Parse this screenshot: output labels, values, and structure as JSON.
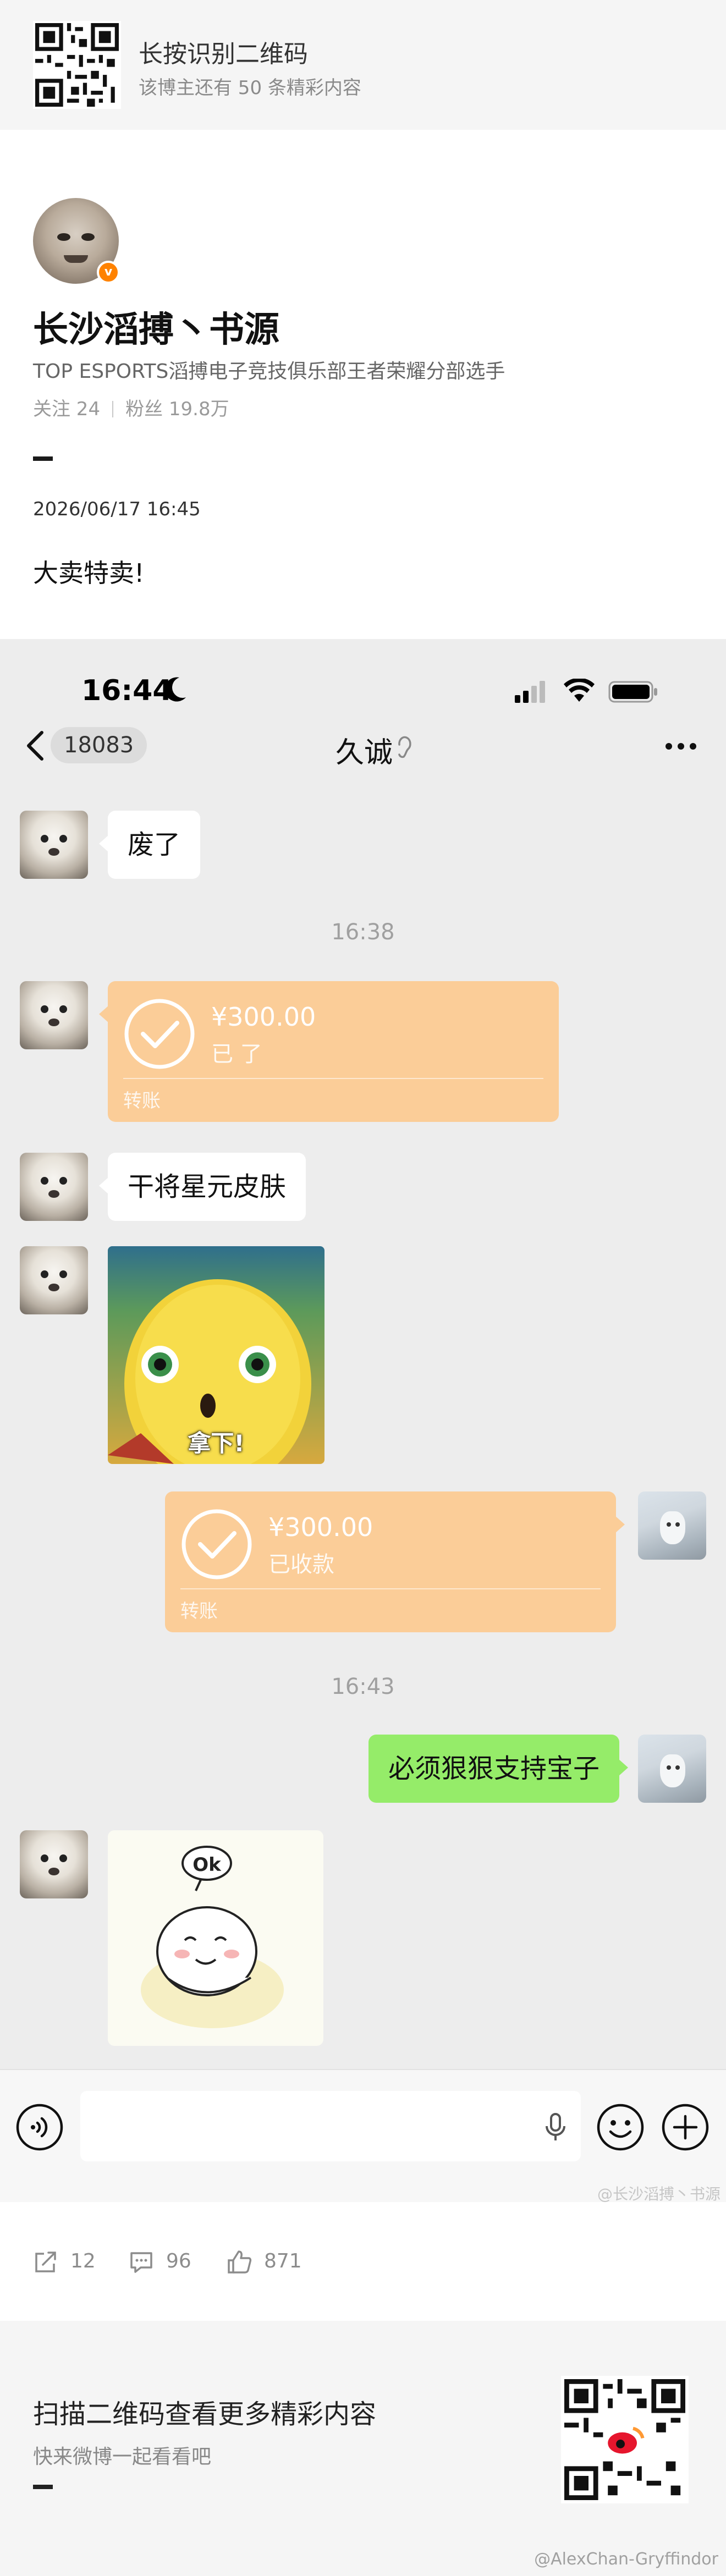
{
  "banner": {
    "title": "长按识别二维码",
    "subtitle": "该博主还有 50 条精彩内容"
  },
  "author": {
    "name": "长沙滔搏丶书源",
    "description": "TOP ESPORTS滔搏电子竞技俱乐部王者荣耀分部选手",
    "following": "关注 24",
    "followers": "粉丝 19.8万",
    "verified_badge": "v"
  },
  "post": {
    "time": "2026/06/17 16:45",
    "text": "大卖特卖!"
  },
  "chat": {
    "status_time": "16:44",
    "unread_count": "18083",
    "title": "久诚",
    "messages": [
      {
        "side": "left",
        "type": "text",
        "text": "废了"
      },
      {
        "type": "timestamp",
        "text": "16:38"
      },
      {
        "side": "left",
        "type": "transfer",
        "amount": "¥300.00",
        "status": "已    了",
        "label": "转账"
      },
      {
        "side": "left",
        "type": "text",
        "text": "干将星元皮肤"
      },
      {
        "side": "left",
        "type": "sticker",
        "caption": "拿下!"
      },
      {
        "side": "right",
        "type": "transfer",
        "amount": "¥300.00",
        "status": "已收款",
        "label": "转账"
      },
      {
        "type": "timestamp",
        "text": "16:43"
      },
      {
        "side": "right",
        "type": "text",
        "text": "必须狠狠支持宝子"
      },
      {
        "side": "left",
        "type": "sticker",
        "caption": "Ok"
      }
    ],
    "watermark": "@长沙滔搏丶书源"
  },
  "actions": {
    "share_count": "12",
    "comment_count": "96",
    "like_count": "871"
  },
  "qr_footer": {
    "title": "扫描二维码查看更多精彩内容",
    "subtitle": "快来微博一起看看吧",
    "handle": "@AlexChan-Gryffindor"
  },
  "colors": {
    "transfer_bubble": "#fbcd98",
    "outgoing_bubble": "#95ec69",
    "weibo_orange": "#ff8200",
    "chat_background": "#ededed"
  },
  "icons": [
    "qr-code-icon",
    "back-icon",
    "ear-icon",
    "more-icon",
    "check-icon",
    "voice-icon",
    "mic-icon",
    "emoji-icon",
    "plus-icon",
    "share-icon",
    "comment-icon",
    "like-icon",
    "moon-icon",
    "signal-icon",
    "wifi-icon",
    "battery-icon"
  ]
}
